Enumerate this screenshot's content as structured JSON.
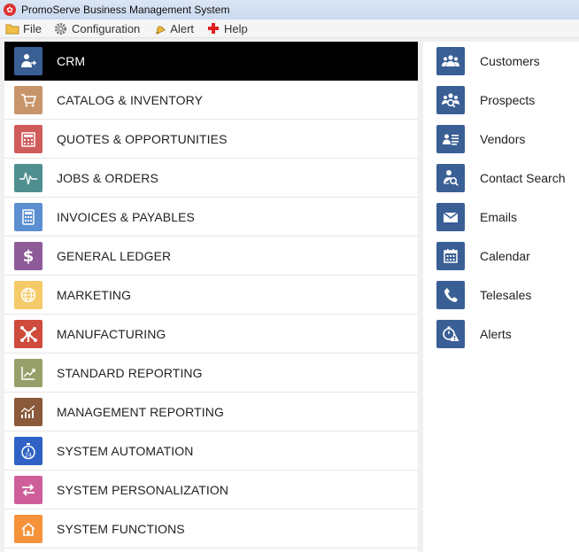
{
  "window": {
    "title": "PromoServe Business Management System"
  },
  "menu": [
    {
      "label": "File",
      "icon": "folder-icon"
    },
    {
      "label": "Configuration",
      "icon": "gear-icon"
    },
    {
      "label": "Alert",
      "icon": "bell-icon"
    },
    {
      "label": "Help",
      "icon": "cross-icon"
    }
  ],
  "modules": [
    {
      "label": "CRM",
      "icon": "person-icon",
      "color": "#3a5f95",
      "active": true
    },
    {
      "label": "CATALOG & INVENTORY",
      "icon": "cart-icon",
      "color": "#c8946a"
    },
    {
      "label": "QUOTES & OPPORTUNITIES",
      "icon": "calculator-icon",
      "color": "#cf5b5b"
    },
    {
      "label": "JOBS & ORDERS",
      "icon": "pulse-icon",
      "color": "#4f8f8f"
    },
    {
      "label": "INVOICES & PAYABLES",
      "icon": "calculator-icon",
      "color": "#5b8fd1"
    },
    {
      "label": "GENERAL LEDGER",
      "icon": "dollar-icon",
      "color": "#8e5b98"
    },
    {
      "label": "MARKETING",
      "icon": "globe-icon",
      "color": "#f5cb6a"
    },
    {
      "label": "MANUFACTURING",
      "icon": "network-icon",
      "color": "#cf4b3b"
    },
    {
      "label": "STANDARD REPORTING",
      "icon": "chart-icon",
      "color": "#97a06a"
    },
    {
      "label": "MANAGEMENT REPORTING",
      "icon": "bar-chart-icon",
      "color": "#8a5a3a"
    },
    {
      "label": "SYSTEM AUTOMATION",
      "icon": "stopwatch-icon",
      "color": "#2f62c4"
    },
    {
      "label": "SYSTEM PERSONALIZATION",
      "icon": "arrows-icon",
      "color": "#cf5f9a"
    },
    {
      "label": "SYSTEM FUNCTIONS",
      "icon": "home-icon",
      "color": "#f5923a"
    }
  ],
  "submenu": [
    {
      "label": "Customers",
      "icon": "people-icon"
    },
    {
      "label": "Prospects",
      "icon": "people-search-icon"
    },
    {
      "label": "Vendors",
      "icon": "id-card-icon"
    },
    {
      "label": "Contact Search",
      "icon": "person-search-icon"
    },
    {
      "label": "Emails",
      "icon": "envelope-icon"
    },
    {
      "label": "Calendar",
      "icon": "calendar-icon"
    },
    {
      "label": "Telesales",
      "icon": "phone-icon"
    },
    {
      "label": "Alerts",
      "icon": "alert-icon"
    }
  ]
}
